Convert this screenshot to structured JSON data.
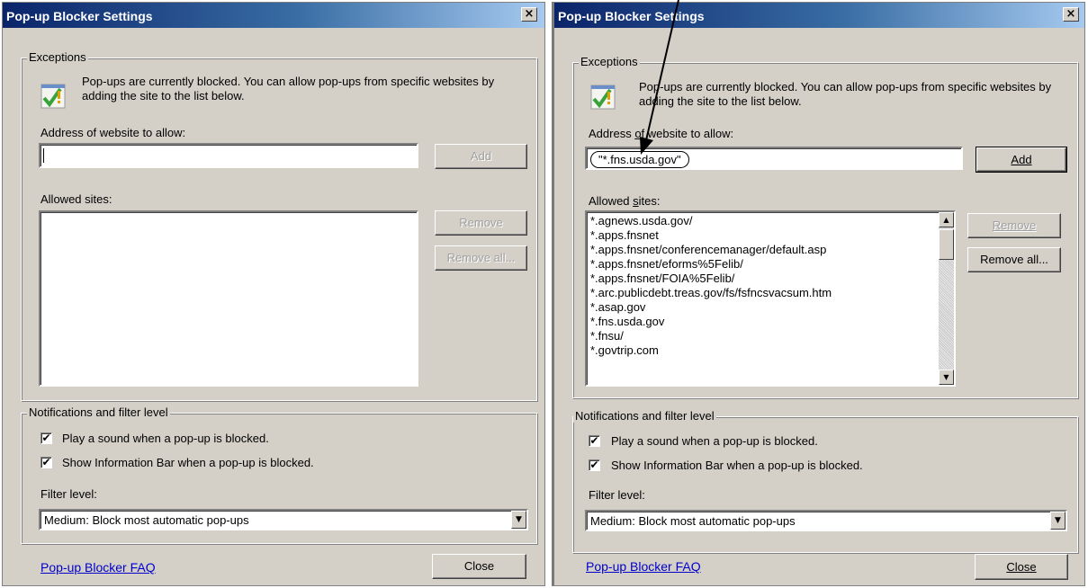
{
  "left_dialog": {
    "title": "Pop-up Blocker Settings",
    "close_glyph": "×",
    "exceptions_legend": "Exceptions",
    "info_text": "Pop-ups are currently blocked.  You can allow pop-ups from specific websites by adding the site to the list below.",
    "address_label": "Address of website to allow:",
    "address_value": "",
    "add_label": "Add",
    "allowed_label": "Allowed sites:",
    "remove_label": "Remove",
    "remove_all_label": "Remove all...",
    "notifications_legend": "Notifications and filter level",
    "play_sound_label": "Play a sound when a pop-up is blocked.",
    "show_infobar_label": "Show Information Bar when a pop-up is blocked.",
    "filter_label": "Filter level:",
    "filter_value": "Medium: Block most automatic pop-ups",
    "faq_link": "Pop-up Blocker FAQ",
    "close_label": "Close"
  },
  "right_dialog": {
    "title": "Pop-up Blocker Settings",
    "close_glyph": "×",
    "exceptions_legend": "Exceptions",
    "info_text": "Pop-ups are currently blocked.  You can allow pop-ups from specific websites by adding the site to the list below.",
    "address_label_pre": "Address ",
    "address_label_u": "o",
    "address_label_post": "f website to allow:",
    "address_value": "\"*.fns.usda.gov\"",
    "add_label": "Add",
    "allowed_label_pre": "Allowed ",
    "allowed_label_u": "s",
    "allowed_label_post": "ites:",
    "allowed_sites": [
      "*.agnews.usda.gov/",
      "*.apps.fnsnet",
      "*.apps.fnsnet/conferencemanager/default.asp",
      "*.apps.fnsnet/eforms%5Felib/",
      "*.apps.fnsnet/FOIA%5Felib/",
      "*.arc.publicdebt.treas.gov/fs/fsfncsvacsum.htm",
      "*.asap.gov",
      "*.fns.usda.gov",
      "*.fnsu/",
      "*.govtrip.com"
    ],
    "remove_label": "Remove",
    "remove_all_label": "Remove all...",
    "notifications_legend": "Notifications and filter level",
    "play_sound_label": "Play a sound when a pop-up is blocked.",
    "show_infobar_label": "Show Information Bar when a pop-up is blocked.",
    "filter_label": "Filter level:",
    "filter_value": "Medium: Block most automatic pop-ups",
    "faq_link": "Pop-up Blocker FAQ",
    "close_label": "Close"
  },
  "icons": {
    "info_icon": "check-warning-icon",
    "checkbox_mark": "✔",
    "arrow_down": "▼",
    "arrow_up": "▲"
  },
  "colors": {
    "dialog_face": "#d4d0c8",
    "title_start": "#0a246a",
    "title_end": "#a6caf0",
    "link": "#0000cc"
  }
}
